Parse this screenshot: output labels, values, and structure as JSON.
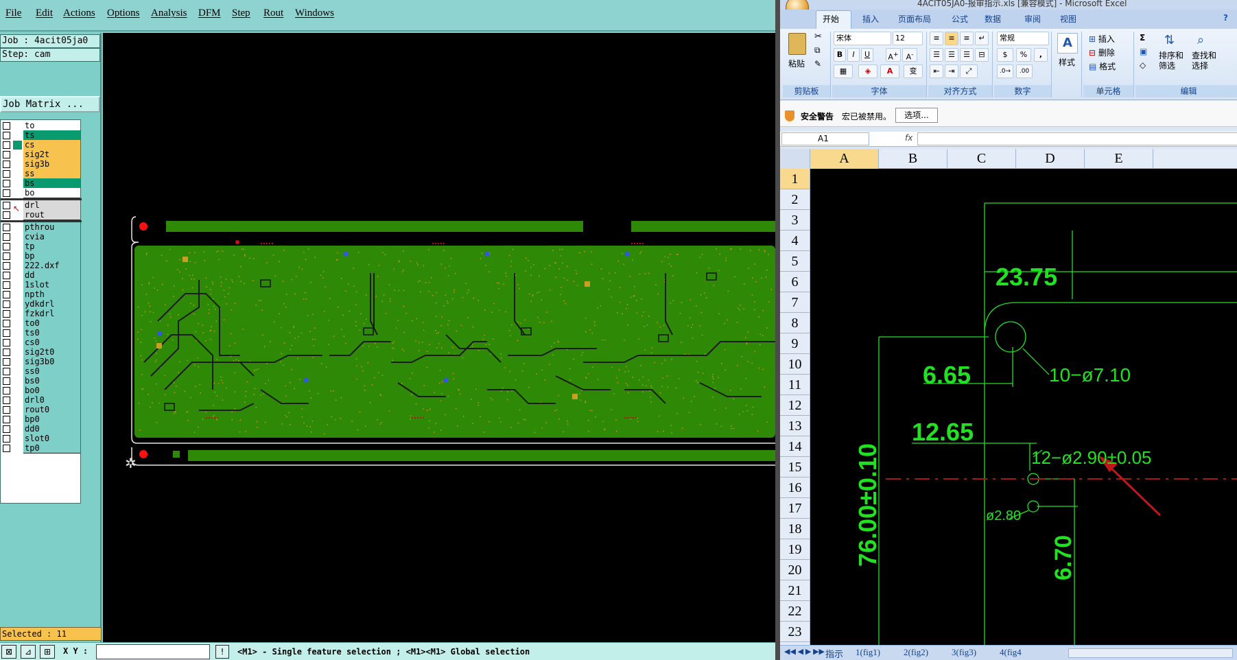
{
  "cam": {
    "menu": [
      "File",
      "Edit",
      "Actions",
      "Options",
      "Analysis",
      "DFM",
      "Step",
      "Rout",
      "Windows"
    ],
    "job_label": "Job : 4acit05ja0",
    "step_label": "Step: cam",
    "job_matrix_button": "Job Matrix ...",
    "layers_board": [
      {
        "name": "to",
        "color": "#ffffff",
        "status": "",
        "mark": "✎"
      },
      {
        "name": "ts",
        "color": "#0a9a70",
        "status": "",
        "mark": ""
      },
      {
        "name": "cs",
        "color": "#f8c24e",
        "status": "#0a9a70",
        "mark": ""
      },
      {
        "name": "sig2t",
        "color": "#f8c24e",
        "status": "",
        "mark": ""
      },
      {
        "name": "sig3b",
        "color": "#f8c24e",
        "status": "",
        "mark": ""
      },
      {
        "name": "ss",
        "color": "#f8c24e",
        "status": "",
        "mark": ""
      },
      {
        "name": "bs",
        "color": "#0a9a70",
        "status": "",
        "mark": ""
      },
      {
        "name": "bo",
        "color": "#ffffff",
        "status": "",
        "mark": "✎"
      }
    ],
    "layers_drill": [
      {
        "name": "drl",
        "color": "#d9d9d9",
        "status": "#1a1aa8",
        "mark": "▪"
      },
      {
        "name": "rout",
        "color": "#d9d9d9",
        "status": "",
        "mark": ""
      }
    ],
    "layers_misc": [
      {
        "name": "pthrou",
        "mark": ""
      },
      {
        "name": "cvia",
        "mark": ""
      },
      {
        "name": "tp",
        "mark": ""
      },
      {
        "name": "bp",
        "mark": ""
      },
      {
        "name": "222.dxf",
        "mark": "✎"
      },
      {
        "name": "dd",
        "mark": ""
      },
      {
        "name": "1slot",
        "mark": ""
      },
      {
        "name": "npth",
        "mark": ""
      },
      {
        "name": "ydkdrl",
        "mark": ""
      },
      {
        "name": "fzkdrl",
        "mark": ""
      },
      {
        "name": "to0",
        "mark": "✎"
      },
      {
        "name": "ts0",
        "mark": ""
      },
      {
        "name": "cs0",
        "mark": ""
      },
      {
        "name": "sig2t0",
        "mark": ""
      },
      {
        "name": "sig3b0",
        "mark": ""
      },
      {
        "name": "ss0",
        "mark": ""
      },
      {
        "name": "bs0",
        "mark": ""
      },
      {
        "name": "bo0",
        "mark": "✎"
      },
      {
        "name": "drl0",
        "mark": ""
      },
      {
        "name": "rout0",
        "mark": ""
      },
      {
        "name": "bp0",
        "mark": ""
      },
      {
        "name": "dd0",
        "mark": ""
      },
      {
        "name": "slot0",
        "mark": ""
      },
      {
        "name": "tp0",
        "mark": ""
      }
    ],
    "misc_color": "#7fcfc9",
    "selected_label": "Selected : 11",
    "xy_label": "X Y :",
    "xy_value": "",
    "hint": "<M1> - Single feature selection ; <M1><M1> Global selection",
    "board_color": "#2e8a06",
    "trace_color": "#1a1a1a",
    "pad_color": "#d79a1a"
  },
  "excel": {
    "title": "4ACIT05JA0-报审指示.xls [兼容模式] - Microsoft Excel",
    "tabs": [
      "开始",
      "插入",
      "页面布局",
      "公式",
      "数据",
      "审阅",
      "视图"
    ],
    "clipboard": {
      "paste": "粘贴",
      "group": "剪贴板"
    },
    "font": {
      "name": "宋体",
      "size": "12",
      "group": "字体",
      "bold": "B",
      "italic": "I",
      "underline": "U"
    },
    "align": {
      "group": "对齐方式"
    },
    "number": {
      "format": "常规",
      "group": "数字",
      "percent": "%"
    },
    "styles": {
      "label": "样式"
    },
    "cells": {
      "insert": "插入",
      "delete": "删除",
      "format": "格式",
      "group": "单元格"
    },
    "editing": {
      "sort": "排序和\n筛选",
      "find": "查找和\n选择",
      "group": "编辑"
    },
    "security": {
      "title": "安全警告",
      "message": "宏已被禁用。",
      "button": "选项..."
    },
    "name_box": "A1",
    "fx": "fx",
    "columns": [
      "A",
      "B",
      "C",
      "D",
      "E"
    ],
    "rows": [
      "1",
      "2",
      "3",
      "4",
      "5",
      "6",
      "7",
      "8",
      "9",
      "10",
      "11",
      "12",
      "13",
      "14",
      "15",
      "16",
      "17",
      "18",
      "19",
      "20",
      "21",
      "22",
      "23"
    ],
    "drawing": {
      "dim1": "23.75",
      "dim2": "6.65",
      "dim3": "10−ø7.10",
      "dim4": "12.65",
      "dim5": "12−ø2.90±0.05",
      "dim6": "76.00±0.10",
      "dim7": "ø2.80",
      "dim8": "6.70",
      "color": "#22e022"
    },
    "sheets": [
      "指示",
      "1(fig1)",
      "2(fig2)",
      "3(fig3)",
      "4(fig4"
    ]
  }
}
